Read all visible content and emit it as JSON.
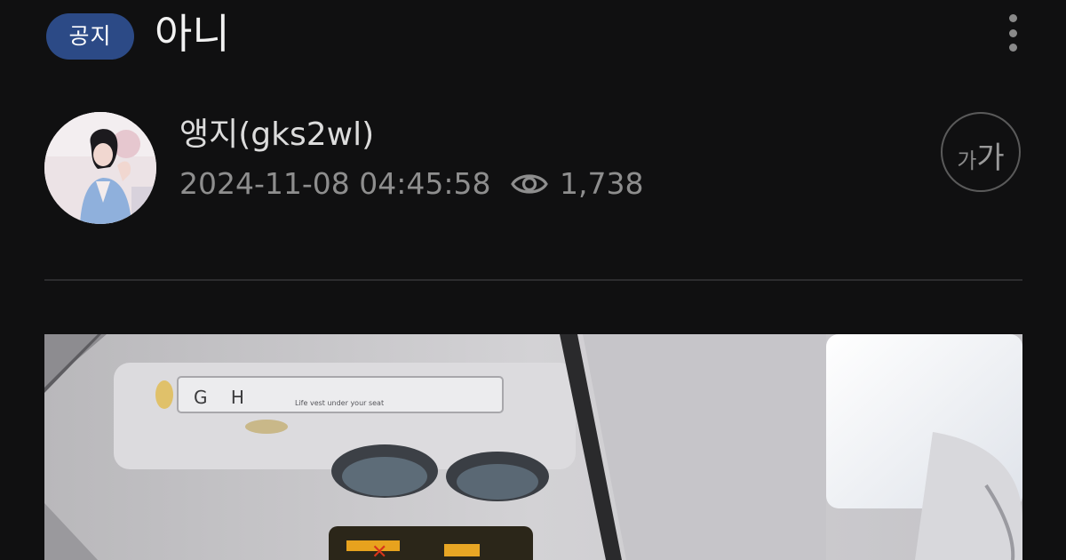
{
  "post": {
    "badge": "공지",
    "title": "아니"
  },
  "author": {
    "name": "앵지(gks2wl)",
    "datetime": "2024-11-08 04:45:58",
    "views": "1,738"
  },
  "font_size_button": {
    "small": "가",
    "large": "가"
  },
  "image": {
    "panel_text": "G H",
    "small_text": "Life vest under your seat"
  },
  "icons": [
    "more-vertical-icon",
    "eye-icon",
    "font-size-icon"
  ],
  "colors": {
    "background": "#101011",
    "badge": "#2c4a86",
    "meta_text": "#8e8e8e"
  }
}
